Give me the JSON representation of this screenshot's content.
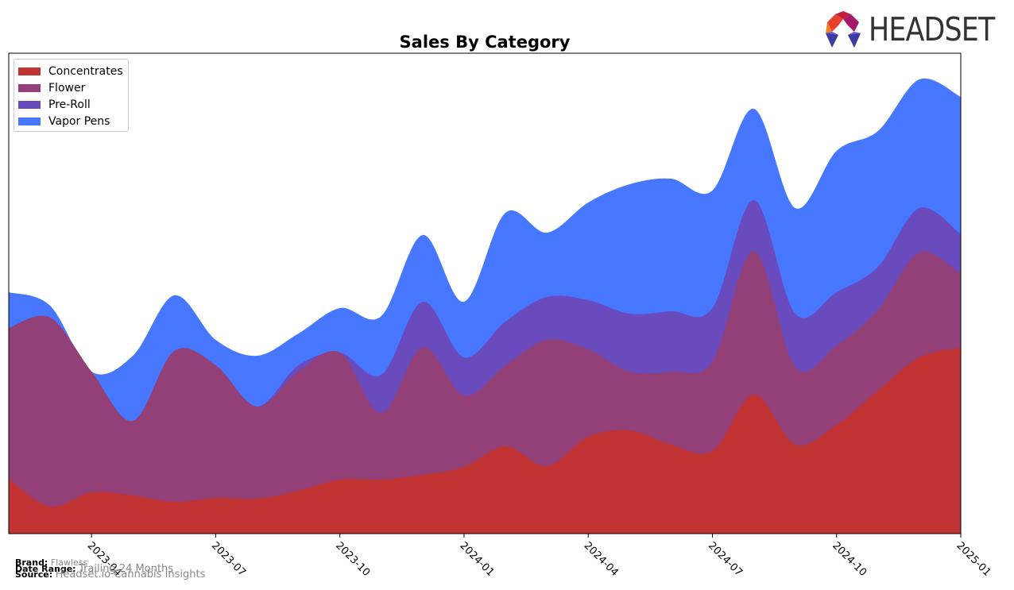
{
  "chart_data": {
    "type": "area",
    "stacked": true,
    "title": "Sales By Category",
    "xlabel": "",
    "ylabel": "",
    "x": [
      "2023-02",
      "2023-03",
      "2023-04",
      "2023-05",
      "2023-06",
      "2023-07",
      "2023-08",
      "2023-09",
      "2023-10",
      "2023-11",
      "2023-12",
      "2024-01",
      "2024-02",
      "2024-03",
      "2024-04",
      "2024-05",
      "2024-06",
      "2024-07",
      "2024-08",
      "2024-09",
      "2024-10",
      "2024-11",
      "2024-12",
      "2025-01"
    ],
    "x_ticks": [
      "2023-04",
      "2023-07",
      "2023-10",
      "2024-01",
      "2024-04",
      "2024-07",
      "2024-10",
      "2025-01"
    ],
    "y_axis_shown": false,
    "grid": false,
    "legend_position": "top-left",
    "series": [
      {
        "name": "Concentrates",
        "color": "#c13232",
        "values": [
          69,
          34,
          52,
          48,
          40,
          45,
          44,
          54,
          68,
          68,
          74,
          84,
          110,
          85,
          122,
          130,
          112,
          104,
          175,
          112,
          137,
          180,
          222,
          234
        ]
      },
      {
        "name": "Flower",
        "color": "#933f78",
        "values": [
          190,
          238,
          152,
          94,
          190,
          167,
          116,
          150,
          160,
          84,
          161,
          90,
          102,
          159,
          110,
          74,
          92,
          113,
          181,
          98,
          100,
          102,
          132,
          93
        ]
      },
      {
        "name": "Pre-Roll",
        "color": "#6a4bbd",
        "values": [
          0,
          0,
          0,
          0,
          0,
          0,
          0,
          8,
          0,
          48,
          57,
          48,
          55,
          54,
          62,
          73,
          76,
          67,
          64,
          67,
          67,
          54,
          56,
          50
        ]
      },
      {
        "name": "Vapor Pens",
        "color": "#4776ff",
        "values": [
          45,
          15,
          0,
          82,
          70,
          32,
          64,
          40,
          56,
          74,
          84,
          70,
          137,
          81,
          123,
          163,
          167,
          148,
          115,
          133,
          178,
          171,
          162,
          173
        ]
      }
    ]
  },
  "footer": {
    "brand_label": "Brand:",
    "brand_value": "Flawless",
    "range_label": "Date Range:",
    "range_value": "Trailing 24 Months",
    "source_label": "Source:",
    "source_value": "Headset.io Cannabis Insights"
  },
  "logo": {
    "text": "HEADSET"
  }
}
